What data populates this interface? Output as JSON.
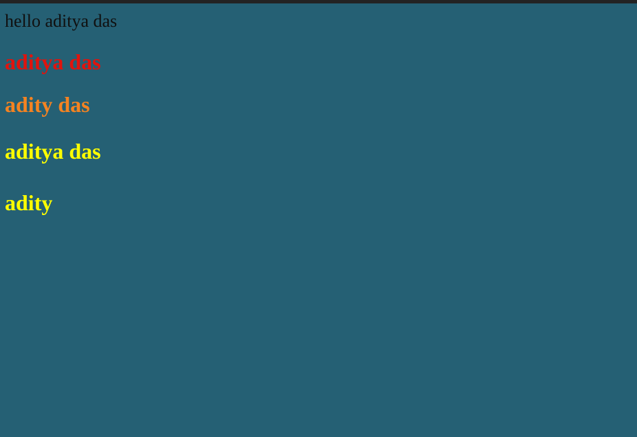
{
  "lines": [
    {
      "text": "hello aditya das",
      "color": "#101010"
    },
    {
      "text": "aditya das",
      "color": "#e1130d"
    },
    {
      "text": "adity das",
      "color": "#f58321"
    },
    {
      "text": "aditya das",
      "color": "#ffff00"
    },
    {
      "text": "adity",
      "color": "#ffff00"
    }
  ],
  "colors": {
    "background": "#256074",
    "top_bar": "#232323"
  }
}
